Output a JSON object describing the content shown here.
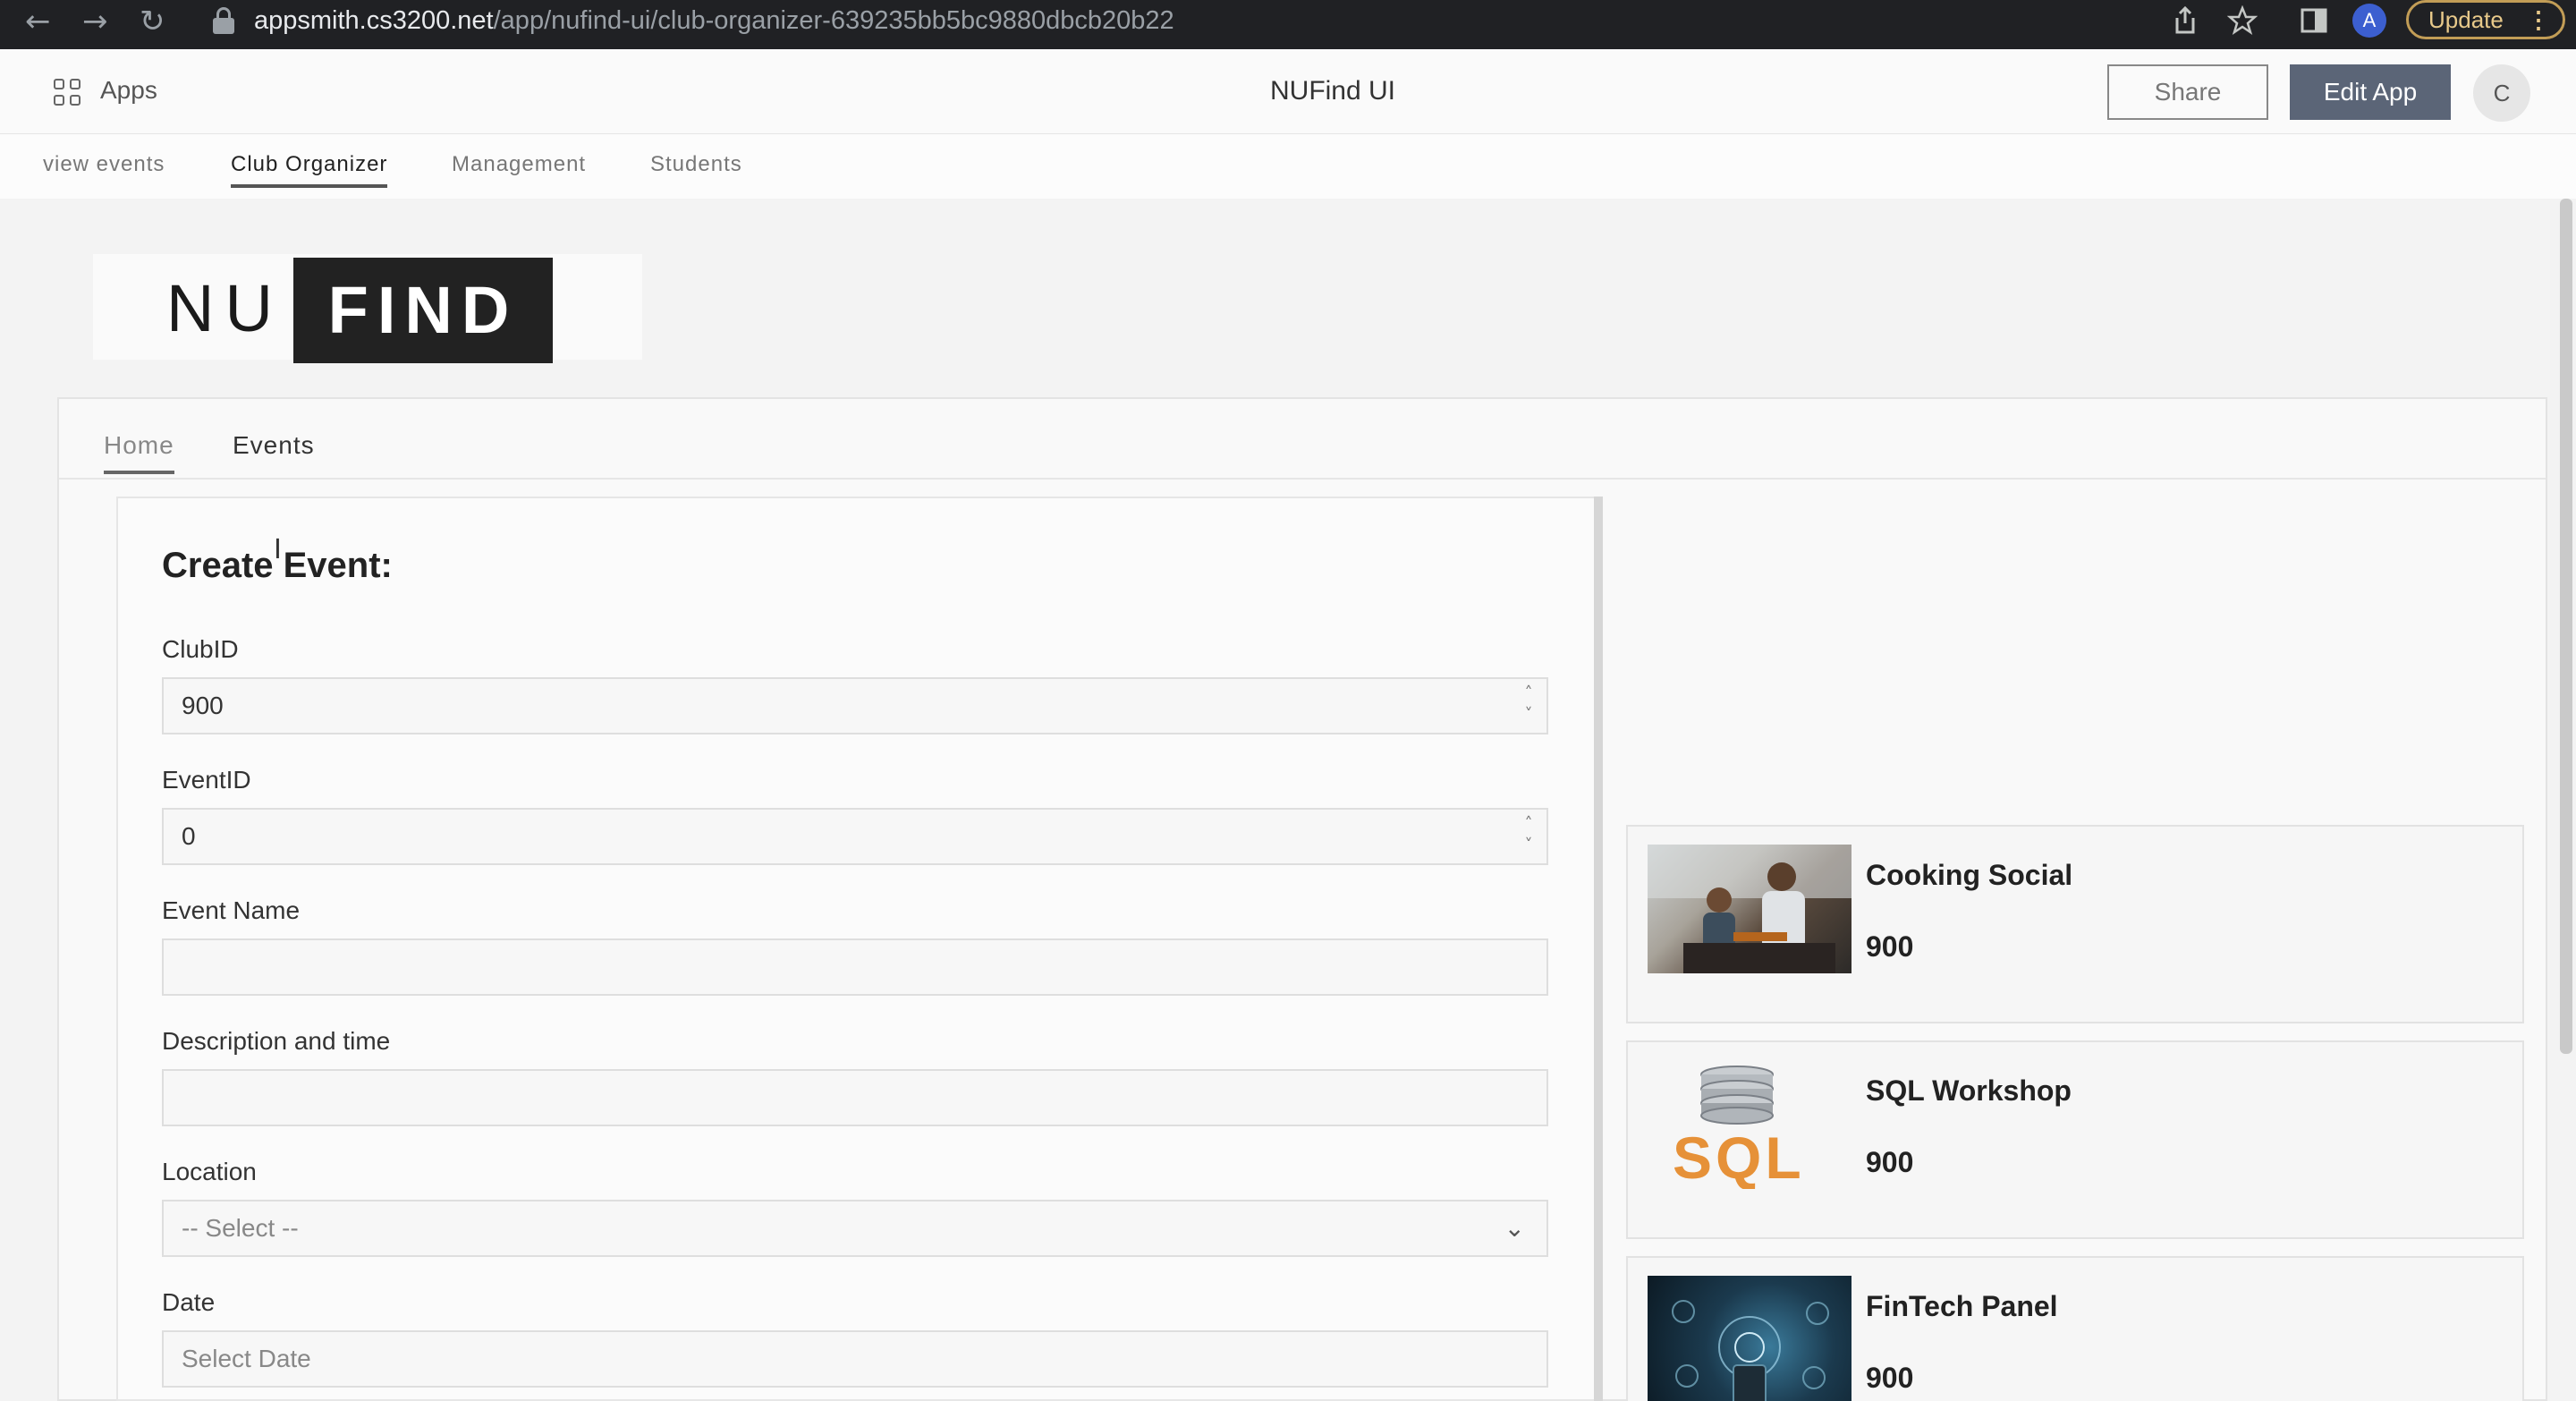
{
  "browser": {
    "back_glyph": "←",
    "forward_glyph": "→",
    "reload_glyph": "↻",
    "url_host": "appsmith.cs3200.net",
    "url_path": "/app/nufind-ui/club-organizer-639235bb5bc9880dbcb20b22",
    "profile_initial": "A",
    "update_label": "Update",
    "update_menu_glyph": "⋮"
  },
  "header": {
    "apps_label": "Apps",
    "app_title": "NUFind UI",
    "share_label": "Share",
    "edit_label": "Edit App",
    "avatar_initial": "C"
  },
  "page_tabs": [
    {
      "label": "view events",
      "active": false
    },
    {
      "label": "Club Organizer",
      "active": true
    },
    {
      "label": "Management",
      "active": false
    },
    {
      "label": "Students",
      "active": false
    }
  ],
  "logo": {
    "left": "NU",
    "right": "FIND"
  },
  "inner_tabs": [
    {
      "label": "Home",
      "active": true
    },
    {
      "label": "Events",
      "active": false
    }
  ],
  "form": {
    "title": "Create Event:",
    "fields": {
      "club_id": {
        "label": "ClubID",
        "value": "900"
      },
      "event_id": {
        "label": "EventID",
        "value": "0"
      },
      "event_name": {
        "label": "Event Name",
        "value": ""
      },
      "description": {
        "label": "Description and time",
        "value": ""
      },
      "location": {
        "label": "Location",
        "value": "-- Select --"
      },
      "date": {
        "label": "Date",
        "placeholder": "Select Date"
      }
    }
  },
  "events": [
    {
      "name": "Cooking Social",
      "club_id": "900",
      "thumb": "cooking-photo"
    },
    {
      "name": "SQL Workshop",
      "club_id": "900",
      "thumb": "sql-database-icon"
    },
    {
      "name": "FinTech Panel",
      "club_id": "900",
      "thumb": "fintech-photo"
    }
  ],
  "colors": {
    "browser_bar": "#202124",
    "edit_button": "#5b6577",
    "sql_orange": "#e69138"
  }
}
